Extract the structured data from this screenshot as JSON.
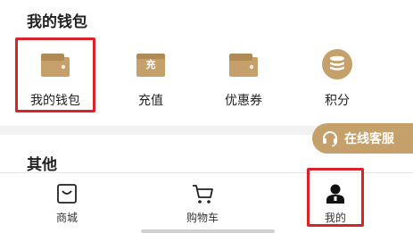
{
  "wallet_section": {
    "title": "我的钱包",
    "items": [
      {
        "label": "我的钱包",
        "icon": "wallet-icon"
      },
      {
        "label": "充值",
        "icon": "recharge-icon",
        "badge": "充"
      },
      {
        "label": "优惠券",
        "icon": "coupon-wallet-icon"
      },
      {
        "label": "积分",
        "icon": "points-coins-icon"
      }
    ]
  },
  "other_section": {
    "title": "其他"
  },
  "service_button": {
    "label": "在线客服",
    "icon": "headset-icon"
  },
  "tabbar": {
    "items": [
      {
        "label": "商城",
        "icon": "shop-bag-icon"
      },
      {
        "label": "购物车",
        "icon": "cart-icon"
      },
      {
        "label": "我的",
        "icon": "user-icon",
        "active": true
      }
    ]
  },
  "colors": {
    "accent_gold": "#c6a06a",
    "highlight_red": "#d8232a",
    "divider_gray": "#f2f2f2"
  }
}
